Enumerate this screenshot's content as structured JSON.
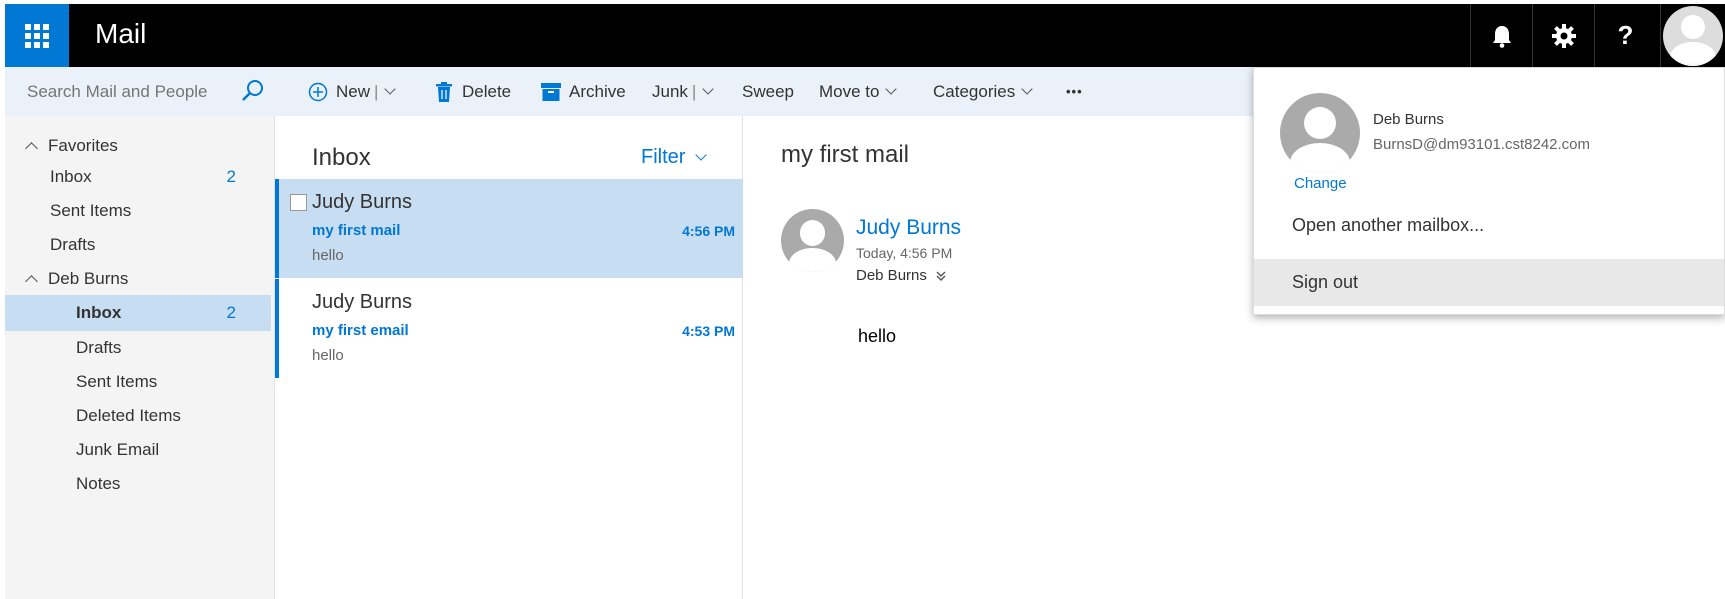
{
  "app": {
    "title": "Mail"
  },
  "search": {
    "placeholder": "Search Mail and People"
  },
  "topbar": {
    "help_label": "?"
  },
  "sidebar": {
    "favorites_label": "Favorites",
    "favorites": [
      {
        "label": "Inbox",
        "count": "2"
      },
      {
        "label": "Sent Items",
        "count": ""
      },
      {
        "label": "Drafts",
        "count": ""
      }
    ],
    "account_label": "Deb Burns",
    "folders": [
      {
        "label": "Inbox",
        "count": "2"
      },
      {
        "label": "Drafts",
        "count": ""
      },
      {
        "label": "Sent Items",
        "count": ""
      },
      {
        "label": "Deleted Items",
        "count": ""
      },
      {
        "label": "Junk Email",
        "count": ""
      },
      {
        "label": "Notes",
        "count": ""
      }
    ]
  },
  "toolbar": {
    "new_label": "New",
    "delete_label": "Delete",
    "archive_label": "Archive",
    "junk_label": "Junk",
    "sweep_label": "Sweep",
    "moveto_label": "Move to",
    "categories_label": "Categories",
    "more_label": "•••"
  },
  "list": {
    "title": "Inbox",
    "filter_label": "Filter",
    "messages": [
      {
        "sender": "Judy Burns",
        "subject": "my first mail",
        "time": "4:56 PM",
        "preview": "hello"
      },
      {
        "sender": "Judy Burns",
        "subject": "my first email",
        "time": "4:53 PM",
        "preview": "hello"
      }
    ]
  },
  "reading": {
    "subject": "my first mail",
    "sender": "Judy Burns",
    "date": "Today, 4:56 PM",
    "to": "Deb Burns",
    "body": "hello"
  },
  "account": {
    "name": "Deb Burns",
    "email": "BurnsD@dm93101.cst8242.com",
    "change_label": "Change",
    "open_mailbox_label": "Open another mailbox...",
    "signout_label": "Sign out"
  },
  "colors": {
    "accent": "#0078d4",
    "selected_bg": "#c7ddf2",
    "command_bar_bg": "#eaf1f9",
    "topbar_bg": "#000000"
  }
}
